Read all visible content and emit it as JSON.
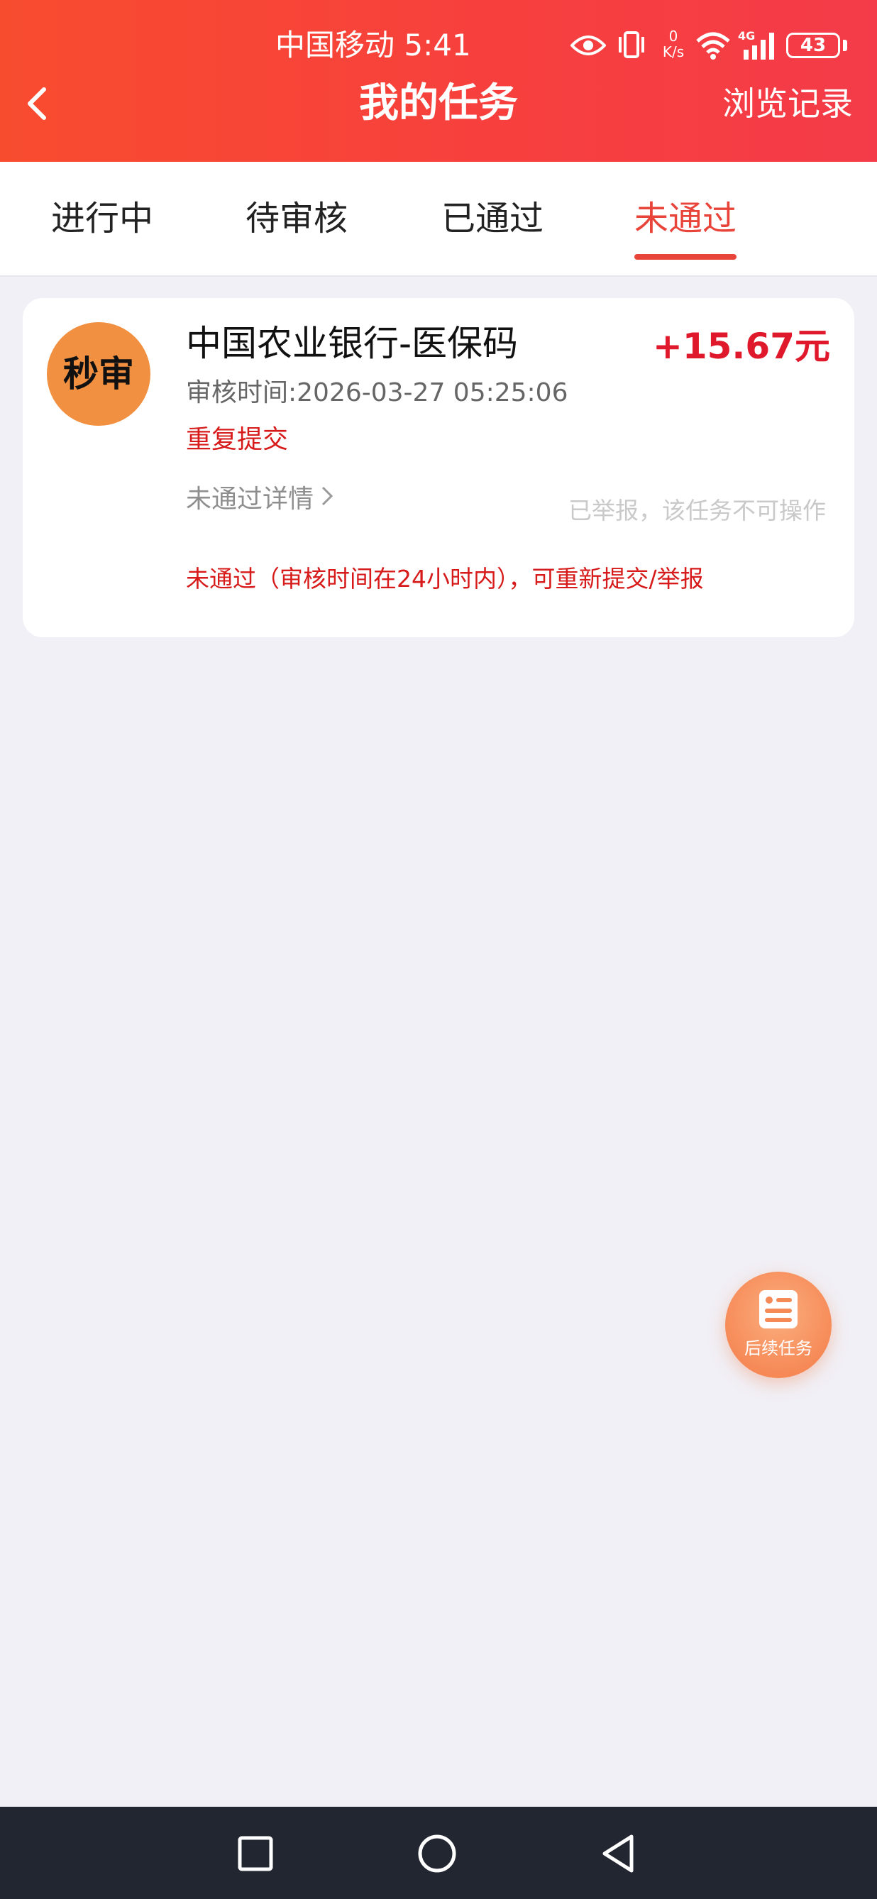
{
  "status_bar": {
    "carrier_time": "中国移动 5:41",
    "speed_top": "0",
    "speed_unit": "K/s",
    "network": "4G",
    "battery": "43"
  },
  "header": {
    "title": "我的任务",
    "history_link": "浏览记录"
  },
  "tabs": [
    {
      "label": "进行中",
      "active": false
    },
    {
      "label": "待审核",
      "active": false
    },
    {
      "label": "已通过",
      "active": false
    },
    {
      "label": "未通过",
      "active": true
    }
  ],
  "task": {
    "badge": "秒审",
    "title": "中国农业银行-医保码",
    "amount": "+15.67元",
    "review_time": "审核时间:2026-03-27 05:25:06",
    "tag": "重复提交",
    "detail_link": "未通过详情",
    "reported_note": "已举报，该任务不可操作",
    "fail_reason": "未通过（审核时间在24小时内），可重新提交/举报"
  },
  "floating_button": {
    "label": "后续任务",
    "icon": "document-list-icon"
  },
  "colors": {
    "header_red": "#f7403d",
    "accent_red": "#e8443a",
    "amount_red": "#e0182b",
    "badge_orange": "#f19041",
    "navbar": "#222631"
  }
}
